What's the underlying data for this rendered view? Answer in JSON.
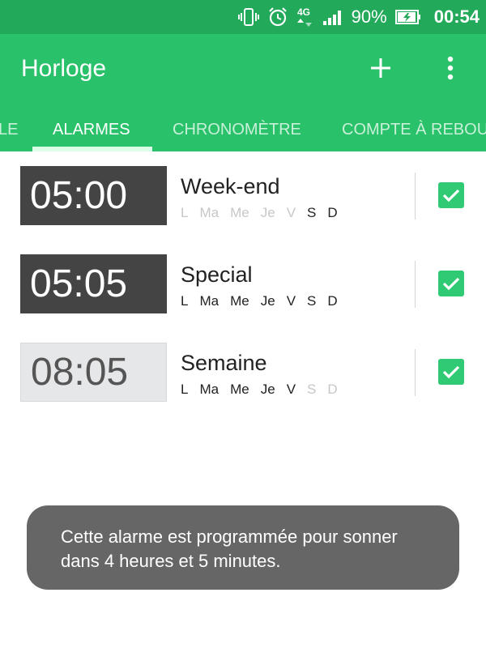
{
  "status_bar": {
    "battery": "90%",
    "time": "00:54",
    "icons": [
      "vibrate-icon",
      "alarm-clock-icon",
      "4g-icon",
      "signal-icon",
      "battery-charging-icon"
    ]
  },
  "app": {
    "title": "Horloge",
    "colors": {
      "status_bar": "#22a95a",
      "app_bar": "#29c169",
      "accent": "#2fca73"
    }
  },
  "tabs": [
    {
      "label": "LE",
      "active": false
    },
    {
      "label": "ALARMES",
      "active": true
    },
    {
      "label": "CHRONOMÈTRE",
      "active": false
    },
    {
      "label": "COMPTE À REBOU",
      "active": false
    }
  ],
  "alarms": [
    {
      "time": "05:00",
      "name": "Week-end",
      "enabled": true,
      "days": [
        {
          "label": "L",
          "active": false
        },
        {
          "label": "Ma",
          "active": false
        },
        {
          "label": "Me",
          "active": false
        },
        {
          "label": "Je",
          "active": false
        },
        {
          "label": "V",
          "active": false
        },
        {
          "label": "S",
          "active": true
        },
        {
          "label": "D",
          "active": true
        }
      ]
    },
    {
      "time": "05:05",
      "name": "Special",
      "enabled": true,
      "days": [
        {
          "label": "L",
          "active": true
        },
        {
          "label": "Ma",
          "active": true
        },
        {
          "label": "Me",
          "active": true
        },
        {
          "label": "Je",
          "active": true
        },
        {
          "label": "V",
          "active": true
        },
        {
          "label": "S",
          "active": true
        },
        {
          "label": "D",
          "active": true
        }
      ]
    },
    {
      "time": "08:05",
      "name": "Semaine",
      "enabled": true,
      "days": [
        {
          "label": "L",
          "active": true
        },
        {
          "label": "Ma",
          "active": true
        },
        {
          "label": "Me",
          "active": true
        },
        {
          "label": "Je",
          "active": true
        },
        {
          "label": "V",
          "active": true
        },
        {
          "label": "S",
          "active": false
        },
        {
          "label": "D",
          "active": false
        }
      ]
    }
  ],
  "toast": {
    "line1": "Cette alarme est programmée pour sonner",
    "line2": "dans 4 heures et 5 minutes."
  }
}
